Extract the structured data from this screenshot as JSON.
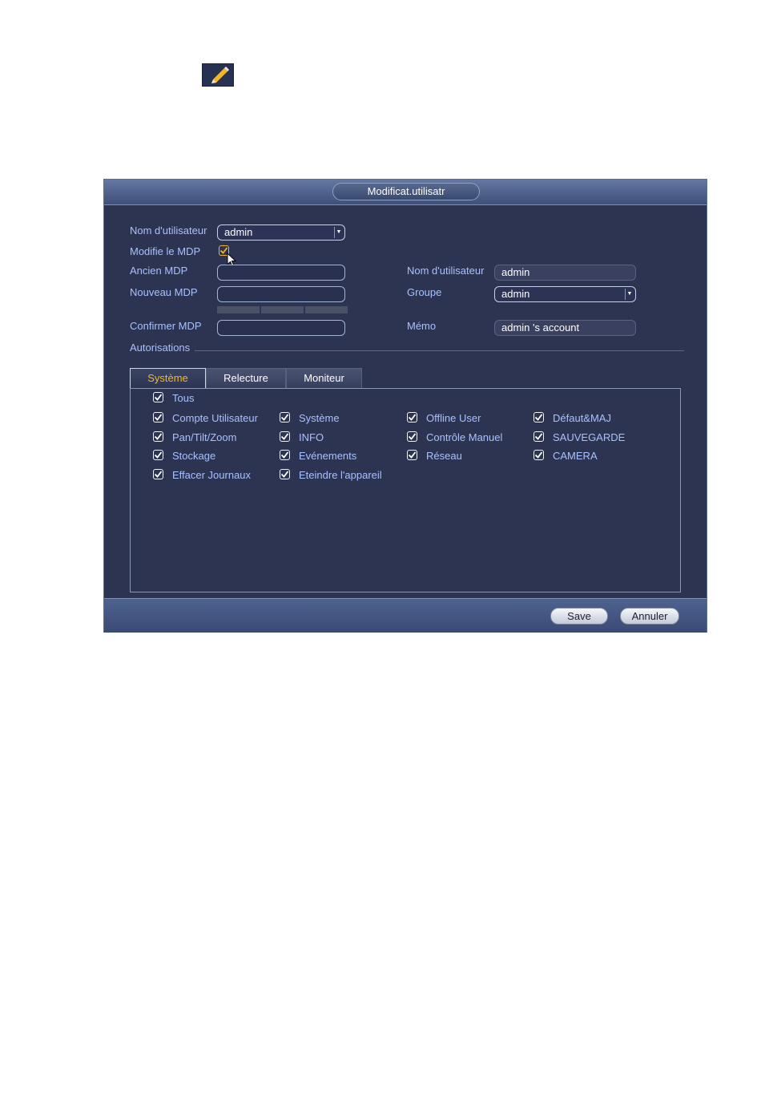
{
  "window": {
    "title": "Modificat.utilisatr"
  },
  "form": {
    "username_label": "Nom d'utilisateur",
    "username_value": "admin",
    "modify_pwd_label": "Modifie le MDP",
    "modify_pwd_checked": true,
    "old_pwd_label": "Ancien MDP",
    "old_pwd_value": "",
    "new_pwd_label": "Nouveau MDP",
    "new_pwd_value": "",
    "confirm_pwd_label": "Confirmer MDP",
    "confirm_pwd_value": "",
    "info_username_label": "Nom d'utilisateur",
    "info_username_value": "admin",
    "group_label": "Groupe",
    "group_value": "admin",
    "memo_label": "Mémo",
    "memo_value": "admin 's account",
    "permissions_label": "Autorisations"
  },
  "tabs": [
    {
      "label": "Système",
      "active": true
    },
    {
      "label": "Relecture",
      "active": false
    },
    {
      "label": "Moniteur",
      "active": false
    }
  ],
  "permissions": {
    "all_label": "Tous",
    "items": [
      "Compte Utilisateur",
      "Système",
      "Offline User",
      "Défaut&MAJ",
      "Pan/Tilt/Zoom",
      "INFO",
      "Contrôle Manuel",
      "SAUVEGARDE",
      "Stockage",
      "Evénements",
      "Réseau",
      "CAMERA",
      "Effacer Journaux",
      "Eteindre l'appareil"
    ]
  },
  "buttons": {
    "save": "Save",
    "cancel": "Annuler"
  },
  "icons": {
    "edit": "pencil-icon",
    "dropdown": "chevron-down-icon",
    "check": "check-icon",
    "cursor": "mouse-cursor-icon"
  },
  "colors": {
    "label": "#a9c0ff",
    "active_tab": "#f2b826",
    "panel_bg": "#2c3452"
  }
}
